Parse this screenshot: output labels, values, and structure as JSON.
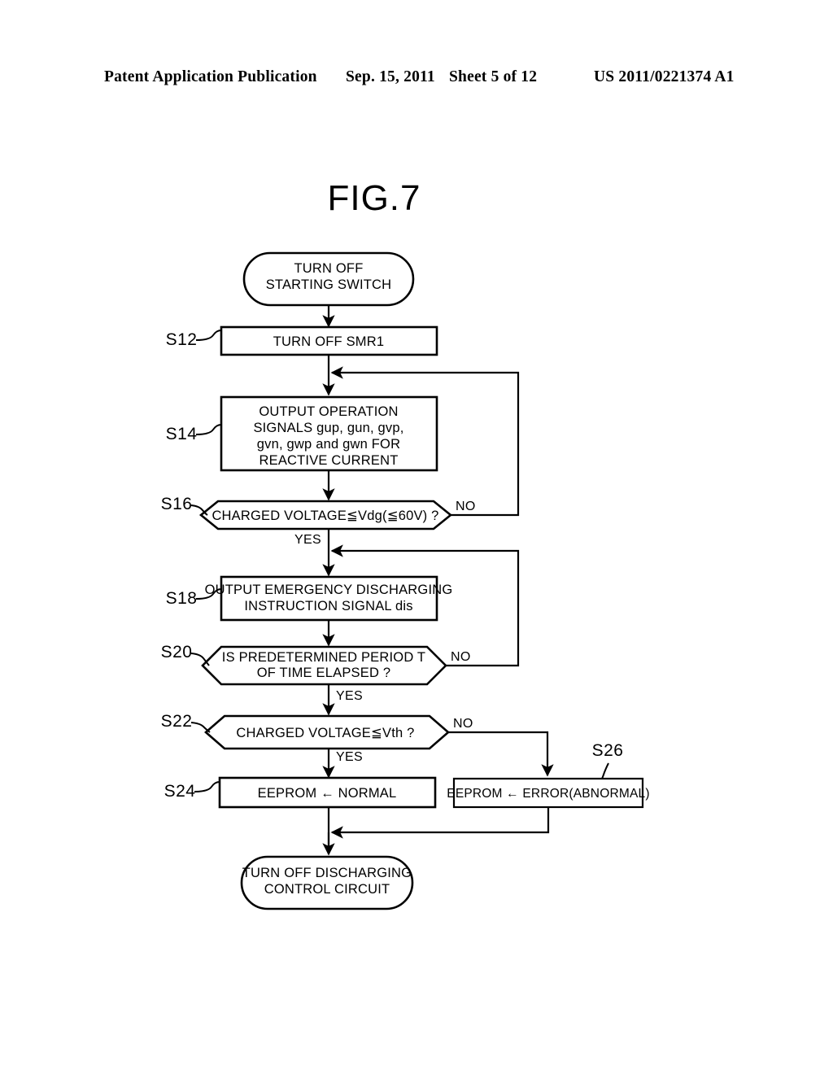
{
  "header": {
    "publication": "Patent Application Publication",
    "date": "Sep. 15, 2011",
    "sheet": "Sheet 5 of 12",
    "patent_number": "US 2011/0221374 A1"
  },
  "figure": {
    "title": "FIG.7"
  },
  "flowchart": {
    "start": {
      "step": "",
      "line1": "TURN OFF",
      "line2": "STARTING SWITCH"
    },
    "s12": {
      "step": "S12",
      "line1": "TURN OFF SMR1"
    },
    "s14": {
      "step": "S14",
      "line1": "OUTPUT OPERATION",
      "line2": "SIGNALS gup, gun, gvp,",
      "line3": "gvn, gwp and gwn FOR",
      "line4": "REACTIVE CURRENT"
    },
    "s16": {
      "step": "S16",
      "line1": "CHARGED VOLTAGE≦Vdg(≦60V) ?",
      "yes": "YES",
      "no": "NO"
    },
    "s18": {
      "step": "S18",
      "line1": "OUTPUT EMERGENCY DISCHARGING",
      "line2": "INSTRUCTION SIGNAL dis"
    },
    "s20": {
      "step": "S20",
      "line1": "IS PREDETERMINED PERIOD T",
      "line2": "OF TIME ELAPSED ?",
      "yes": "YES",
      "no": "NO"
    },
    "s22": {
      "step": "S22",
      "line1": "CHARGED VOLTAGE≦Vth ?",
      "yes": "YES",
      "no": "NO"
    },
    "s24": {
      "step": "S24",
      "line1": "EEPROM ← NORMAL"
    },
    "s26": {
      "step": "S26",
      "line1": "EEPROM ← ERROR(ABNORMAL)"
    },
    "end": {
      "step": "",
      "line1": "TURN OFF DISCHARGING",
      "line2": "CONTROL CIRCUIT"
    }
  },
  "colors": {
    "ink": "#000000",
    "paper": "#ffffff"
  }
}
